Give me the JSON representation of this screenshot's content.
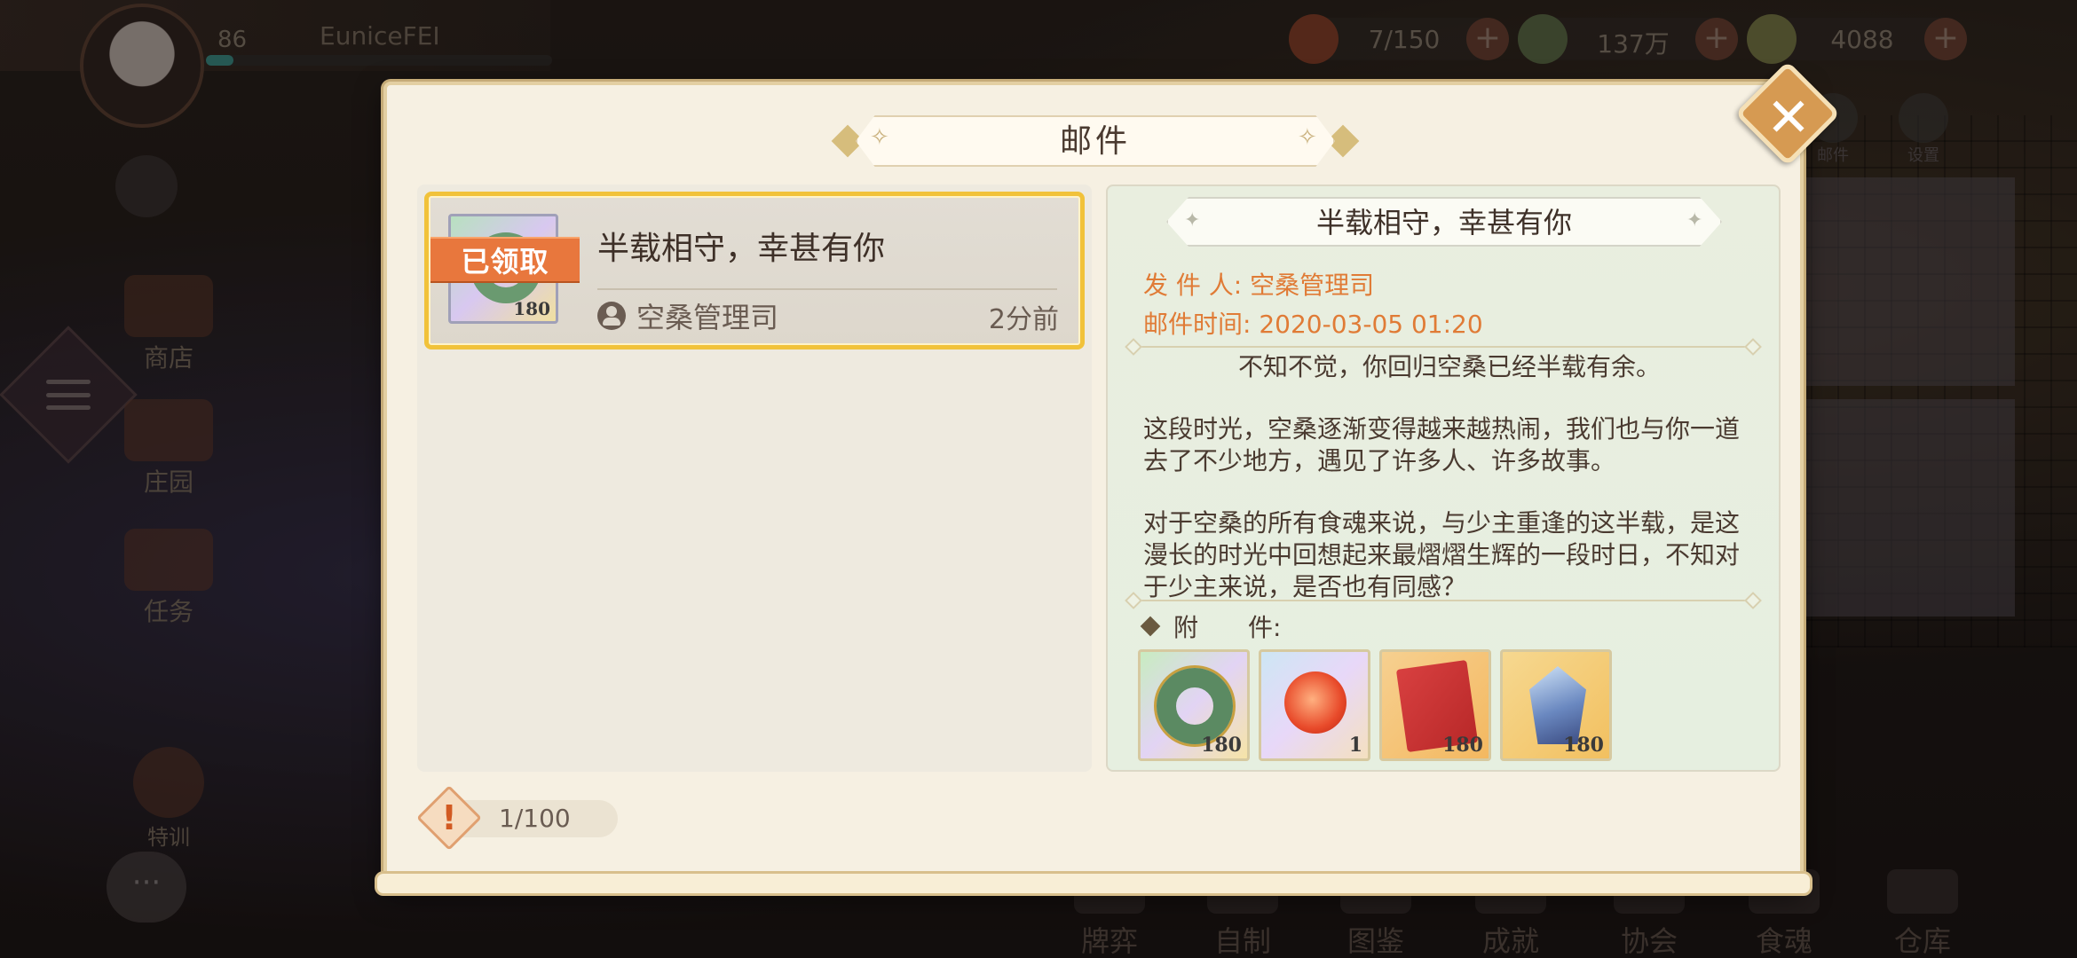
{
  "header": {
    "level": "86",
    "username": "EuniceFEI",
    "resources": [
      {
        "icon": "food-bowl-icon",
        "value": "7/150"
      },
      {
        "icon": "leaf-coin-icon",
        "value": "137万"
      },
      {
        "icon": "jade-ring-icon",
        "value": "4088"
      }
    ],
    "add_symbol": "+"
  },
  "sidebar": {
    "items": [
      {
        "label": "商店",
        "icon": "shop-icon"
      },
      {
        "label": "庄园",
        "icon": "manor-icon"
      },
      {
        "label": "任务",
        "icon": "scroll-icon"
      },
      {
        "label": "特训",
        "icon": "training-icon"
      }
    ]
  },
  "top_right": {
    "items": [
      {
        "label": "邮件",
        "icon": "mail-icon"
      },
      {
        "label": "设置",
        "icon": "gear-icon"
      }
    ]
  },
  "bottom_nav": {
    "items": [
      {
        "label": "牌弈"
      },
      {
        "label": "自制"
      },
      {
        "label": "图鉴"
      },
      {
        "label": "成就"
      },
      {
        "label": "协会"
      },
      {
        "label": "食魂"
      },
      {
        "label": "仓库"
      }
    ]
  },
  "dialog": {
    "title": "邮件",
    "close_symbol": "✕",
    "mail_list": [
      {
        "title": "半载相守，幸甚有你",
        "sender": "空桑管理司",
        "time": "2分前",
        "status_tag": "已领取",
        "thumb_count": "180"
      }
    ],
    "detail": {
      "title": "半载相守，幸甚有你",
      "sender_label": "发 件 人:",
      "sender": "空桑管理司",
      "time_label": "邮件时间:",
      "time": "2020-03-05 01:20",
      "paragraphs": [
        "不知不觉，你回归空桑已经半载有余。",
        "这段时光，空桑逐渐变得越来越热闹，我们也与你一道去了不少地方，遇见了许多人、许多故事。",
        "对于空桑的所有食魂来说，与少主重逢的这半载，是这漫长的时光中回想起来最熠熠生辉的一段时日，不知对于少主来说，是否也有同感？"
      ],
      "attachments_label": "附　　件:",
      "attachments": [
        {
          "icon": "jade-ring-icon",
          "count": "180"
        },
        {
          "icon": "fire-spirit-icon",
          "count": "1"
        },
        {
          "icon": "red-book-icon",
          "count": "180"
        },
        {
          "icon": "blue-gem-icon",
          "count": "180"
        }
      ]
    },
    "footer": {
      "alert_symbol": "!",
      "mail_count": "1/100"
    }
  }
}
